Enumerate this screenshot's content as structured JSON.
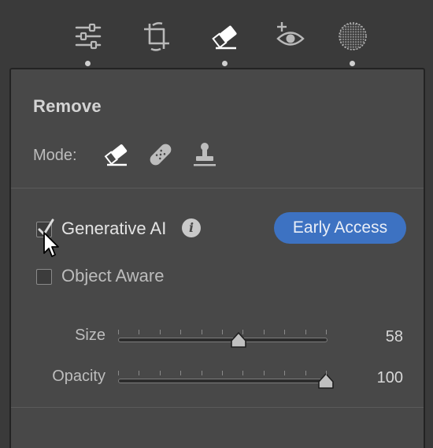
{
  "toolbar": {
    "tools": [
      {
        "name": "edit-sliders",
        "active": false
      },
      {
        "name": "crop",
        "active": false
      },
      {
        "name": "remove",
        "active": true
      },
      {
        "name": "red-eye",
        "active": false
      },
      {
        "name": "masking",
        "active": false
      }
    ]
  },
  "panel": {
    "title": "Remove",
    "mode_label": "Mode:",
    "modes": [
      "eraser-icon",
      "bandage-icon",
      "stamp-icon"
    ],
    "generative_ai": {
      "label": "Generative AI",
      "checked": true
    },
    "info_glyph": "i",
    "badge": "Early Access",
    "object_aware": {
      "label": "Object Aware",
      "checked": false
    },
    "size": {
      "label": "Size",
      "value": "58",
      "fraction": 0.58
    },
    "opacity": {
      "label": "Opacity",
      "value": "100",
      "fraction": 1.0
    }
  },
  "colors": {
    "accent": "#3d72c2",
    "panel": "#484848",
    "background": "#3a3a3a"
  }
}
